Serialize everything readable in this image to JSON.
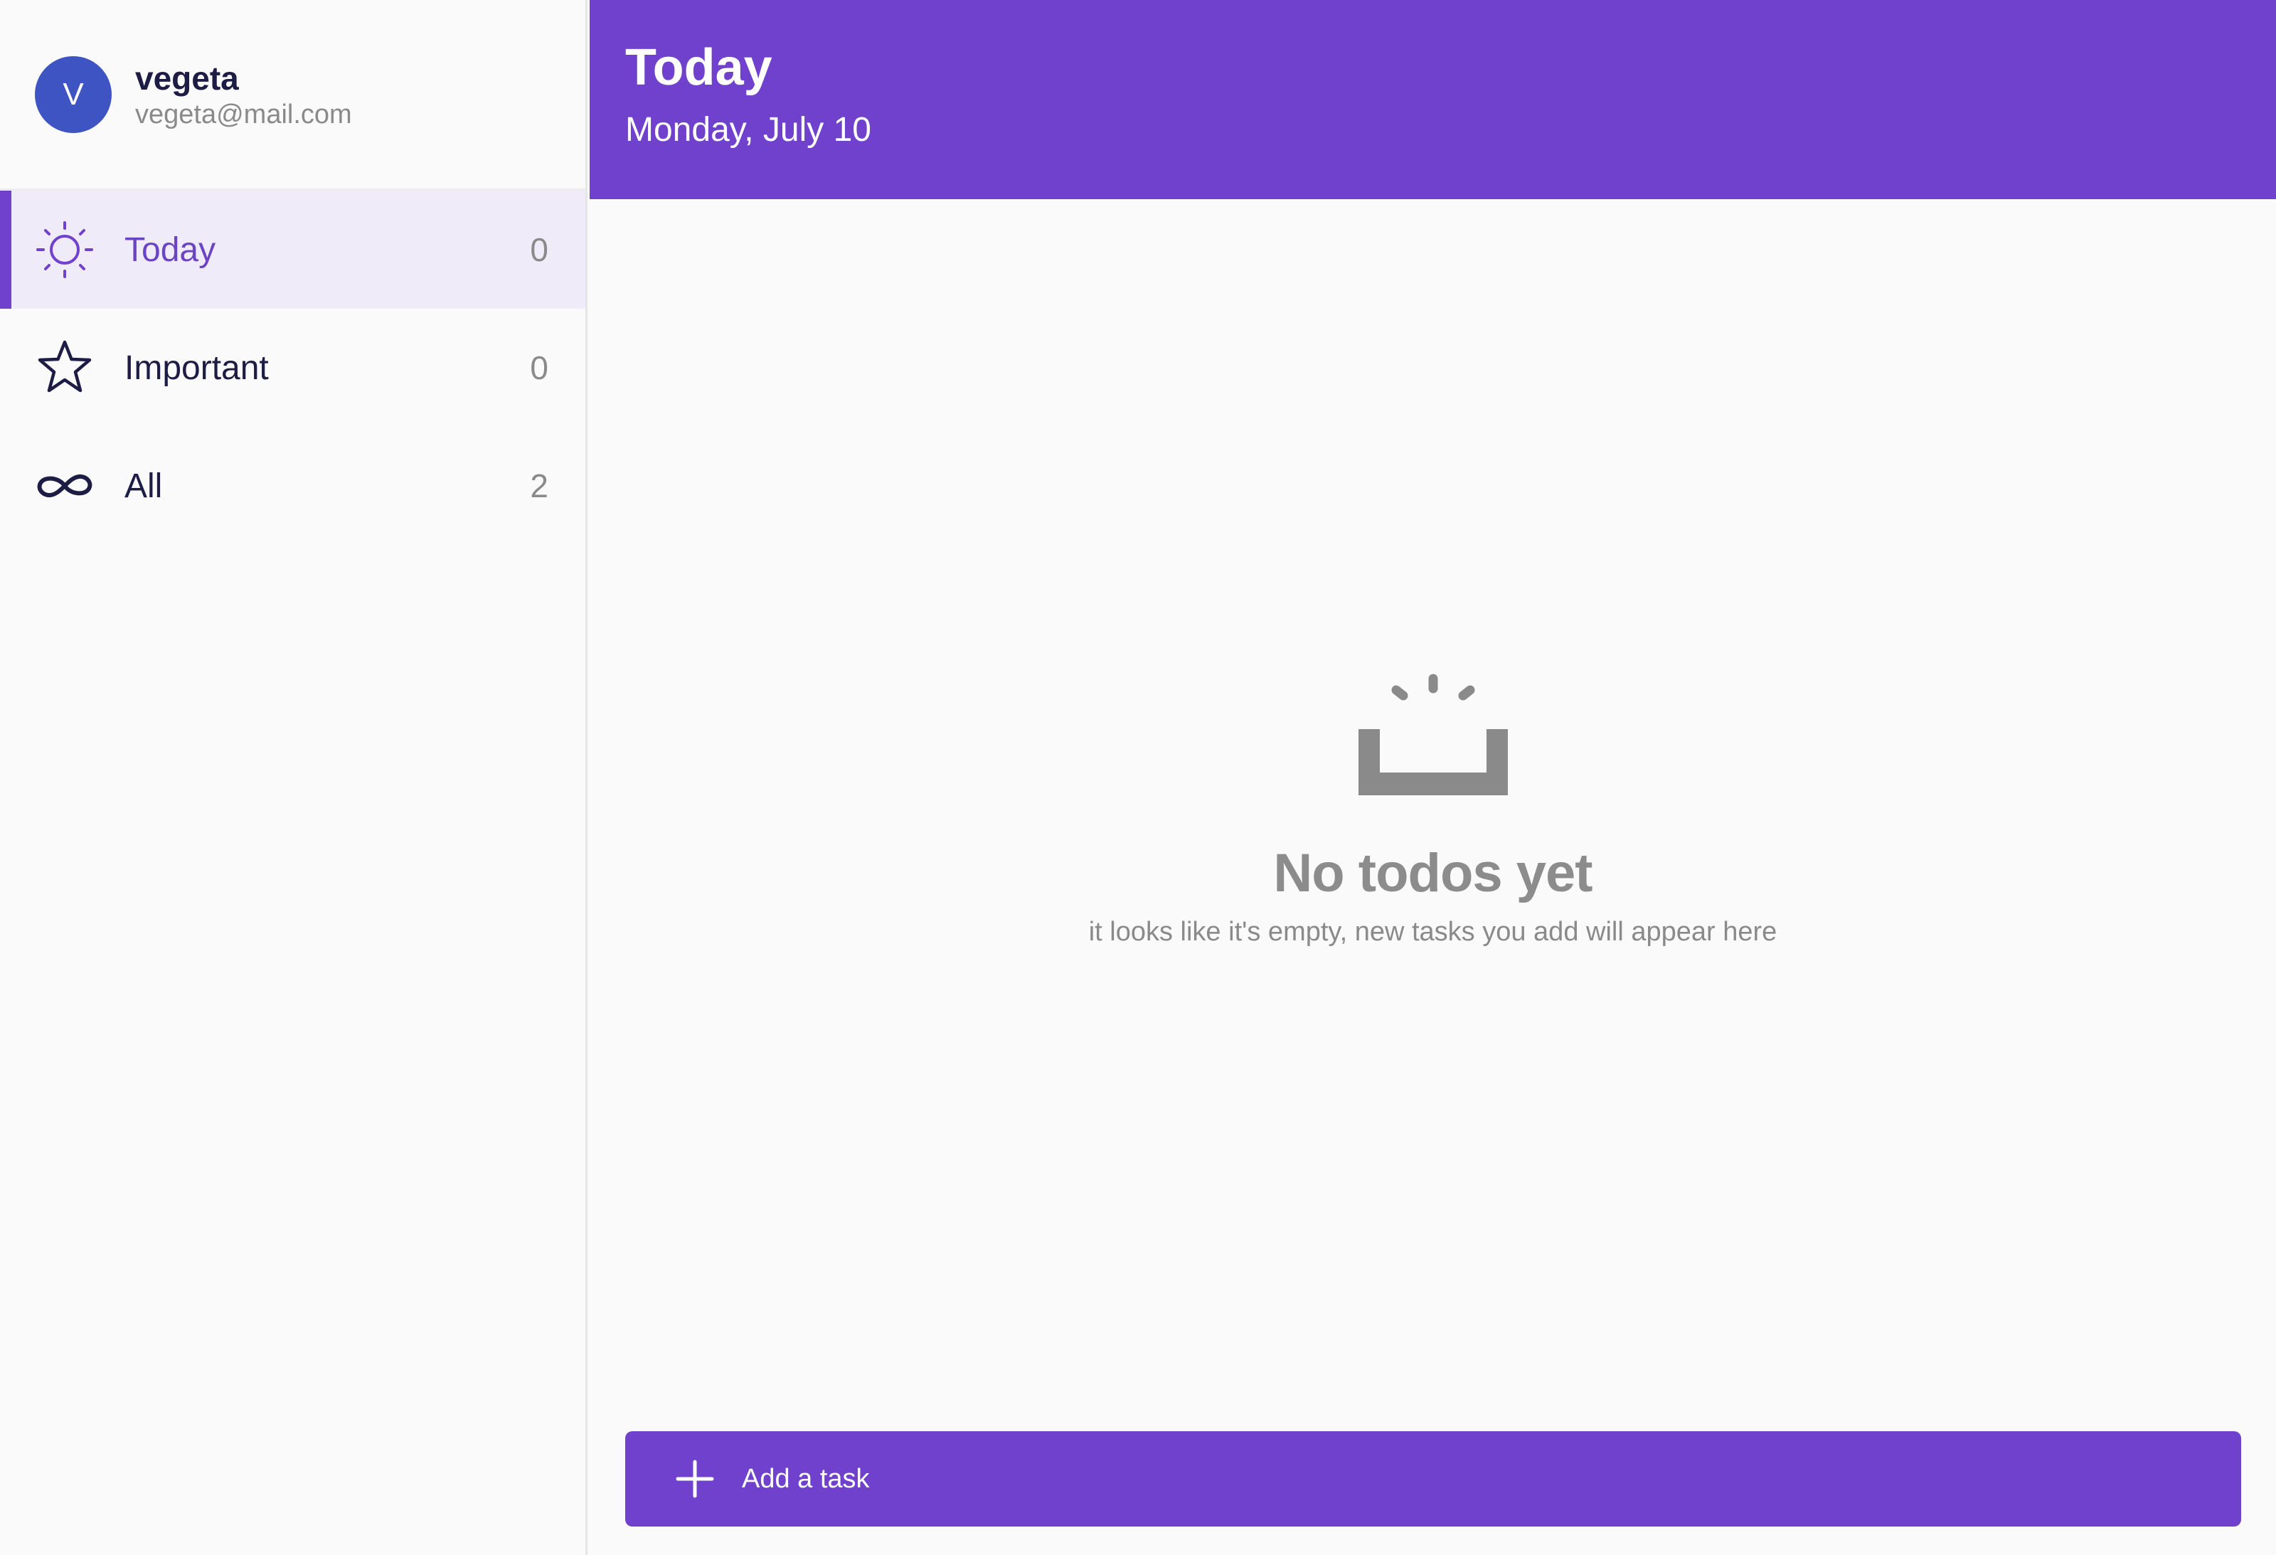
{
  "user": {
    "initial": "V",
    "name": "vegeta",
    "email": "vegeta@mail.com"
  },
  "sidebar": {
    "items": [
      {
        "label": "Today",
        "count": "0",
        "icon": "sun-icon",
        "active": true
      },
      {
        "label": "Important",
        "count": "0",
        "icon": "star-icon",
        "active": false
      },
      {
        "label": "All",
        "count": "2",
        "icon": "infinity-icon",
        "active": false
      }
    ]
  },
  "header": {
    "title": "Today",
    "date": "Monday, July 10"
  },
  "empty_state": {
    "icon": "empty-inbox-icon",
    "title": "No todos yet",
    "subtitle": "it looks like it's empty, new tasks you add will appear here"
  },
  "add_task": {
    "label": "Add a task",
    "icon": "plus-icon"
  },
  "colors": {
    "accent": "#7041cd",
    "avatar": "#3f54c3",
    "active_bg": "#efebf9",
    "text_dark": "#1c1c44",
    "muted": "#8a8a8a"
  }
}
